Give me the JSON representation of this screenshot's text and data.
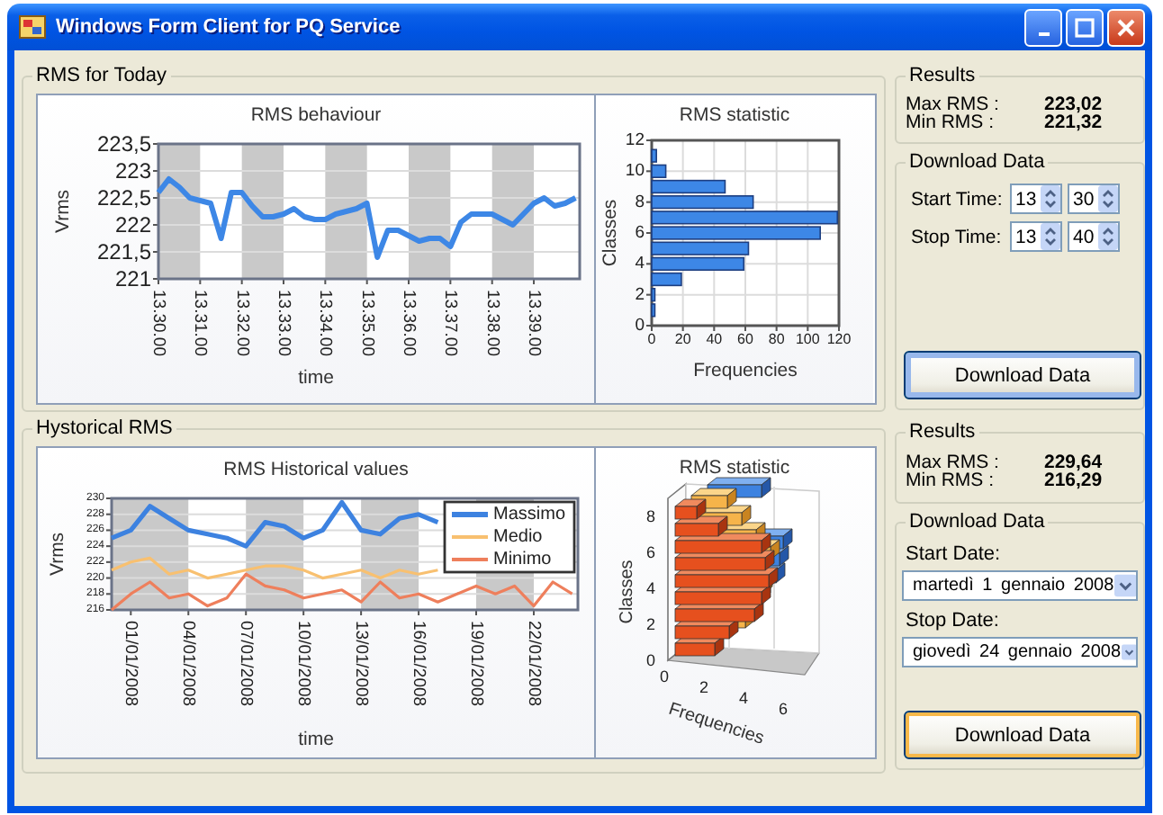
{
  "window": {
    "title": "Windows Form Client for PQ Service"
  },
  "today": {
    "group_title": "RMS for Today",
    "rms_chart": {
      "chart_data": {
        "type": "line",
        "title": "RMS behaviour",
        "xlabel": "time",
        "ylabel": "Vrms",
        "categories": [
          "13.30.00",
          null,
          null,
          null,
          "13.31.00",
          null,
          null,
          null,
          "13.32.00",
          null,
          null,
          null,
          "13.33.00",
          null,
          null,
          null,
          "13.34.00",
          null,
          null,
          null,
          "13.35.00",
          null,
          null,
          null,
          "13.36.00",
          null,
          null,
          null,
          "13.37.00",
          null,
          null,
          null,
          "13.38.00",
          null,
          null,
          null,
          "13.39.00",
          null,
          null,
          null,
          null
        ],
        "series": [
          {
            "color": "#3d87e6",
            "values": [
              222.6,
              222.85,
              222.7,
              222.5,
              222.45,
              222.4,
              221.75,
              222.6,
              222.6,
              222.35,
              222.15,
              222.15,
              222.2,
              222.3,
              222.15,
              222.1,
              222.1,
              222.2,
              222.25,
              222.3,
              222.4,
              221.4,
              221.9,
              221.9,
              221.8,
              221.7,
              221.75,
              221.75,
              221.6,
              222.05,
              222.2,
              222.2,
              222.2,
              222.1,
              222.0,
              222.2,
              222.4,
              222.5,
              222.35,
              222.4,
              222.5
            ]
          }
        ],
        "ylim": [
          221,
          223.5
        ],
        "grid": true,
        "yticks": [
          {
            "value": 221,
            "label": "221"
          },
          {
            "value": 221.5,
            "label": "221,5"
          },
          {
            "value": 222,
            "label": "222"
          },
          {
            "value": 222.5,
            "label": "222,5"
          },
          {
            "value": 223,
            "label": "223"
          },
          {
            "value": 223.5,
            "label": "223,5"
          }
        ]
      }
    },
    "stat_chart": {
      "chart_data": {
        "type": "bar",
        "orientation": "horizontal",
        "title": "RMS statistic",
        "xlabel": "Frequencies",
        "ylabel": "Classes",
        "x": [
          1,
          2,
          3,
          4,
          5,
          6,
          7,
          8,
          9,
          10,
          11
        ],
        "series": [
          {
            "color": "#3d87e6",
            "values": [
              2,
              2,
              19,
              59,
              62,
              108,
              119,
              65,
              47,
              9,
              3
            ]
          }
        ],
        "xlim": [
          0,
          120
        ],
        "ylim": [
          0,
          12
        ],
        "grid": true,
        "xticks": [
          0,
          20,
          40,
          60,
          80,
          100,
          120
        ],
        "yticks": [
          0,
          2,
          4,
          6,
          8,
          10,
          12
        ]
      }
    },
    "results": {
      "title": "Results",
      "rows": [
        {
          "label": "Max RMS :",
          "value": "223,02"
        },
        {
          "label": "Min RMS :",
          "value": "221,32"
        }
      ]
    },
    "download": {
      "title": "Download Data",
      "fields": [
        {
          "label": "Start Time:",
          "hour": "13",
          "minute": "30"
        },
        {
          "label": "Stop Time:",
          "hour": "13",
          "minute": "40"
        }
      ],
      "button": {
        "label": "Download Data",
        "focused": true,
        "hovered": false
      }
    }
  },
  "historical": {
    "group_title": "Hystorical RMS",
    "rms_chart": {
      "chart_data": {
        "type": "line",
        "title": "RMS Historical values",
        "xlabel": "time",
        "ylabel": "Vrms",
        "categories": [
          null,
          "01/01/2008",
          null,
          null,
          "04/01/2008",
          null,
          null,
          "07/01/2008",
          null,
          null,
          "10/01/2008",
          null,
          null,
          "13/01/2008",
          null,
          null,
          "16/01/2008",
          null,
          null,
          "19/01/2008",
          null,
          null,
          "22/01/2008",
          null,
          null
        ],
        "series": [
          {
            "name": "Massimo",
            "color": "#3d82e0",
            "values": [
              225,
              226,
              229,
              227.5,
              226,
              225.5,
              225,
              224,
              227,
              226.5,
              225,
              226,
              229.5,
              226,
              225.5,
              227.5,
              228,
              227,
              null,
              null,
              null,
              null,
              null,
              null,
              null
            ]
          },
          {
            "name": "Medio",
            "color": "#f8c070",
            "values": [
              221,
              222,
              222.5,
              220.5,
              221,
              220,
              220.5,
              221,
              221.5,
              221.5,
              221,
              220,
              220.5,
              221,
              220,
              221,
              220.5,
              221,
              null,
              null,
              null,
              null,
              null,
              null,
              null
            ]
          },
          {
            "name": "Minimo",
            "color": "#ee7f5c",
            "values": [
              216,
              218,
              219.5,
              217.5,
              218,
              216.5,
              217.5,
              220.5,
              219,
              218.5,
              217.5,
              218,
              218.5,
              217,
              219.5,
              217.5,
              218,
              217,
              218,
              219,
              218,
              219,
              216.5,
              219.5,
              218
            ]
          }
        ],
        "ylim": [
          216,
          230
        ],
        "grid": true,
        "legend": "upper right",
        "yticks": [
          216,
          218,
          220,
          222,
          224,
          226,
          228,
          230
        ]
      }
    },
    "stat_chart": {
      "title": "RMS statistic",
      "xlabel": "Frequencies",
      "ylabel": "Classes",
      "xtick_labels": [
        "0",
        "2",
        "4",
        "6"
      ],
      "ytick_labels": [
        "8",
        "6",
        "4",
        "2",
        "0"
      ]
    },
    "results": {
      "title": "Results",
      "rows": [
        {
          "label": "Max RMS :",
          "value": "229,64"
        },
        {
          "label": "Min RMS :",
          "value": "216,29"
        }
      ]
    },
    "download": {
      "title": "Download Data",
      "fields": [
        {
          "label": "Start Date:",
          "value": "martedì 1 gennaio 2008"
        },
        {
          "label": "Stop Date:",
          "value": "giovedì 24 gennaio 2008"
        }
      ],
      "button": {
        "label": "Download Data",
        "focused": false,
        "hovered": true
      }
    }
  }
}
